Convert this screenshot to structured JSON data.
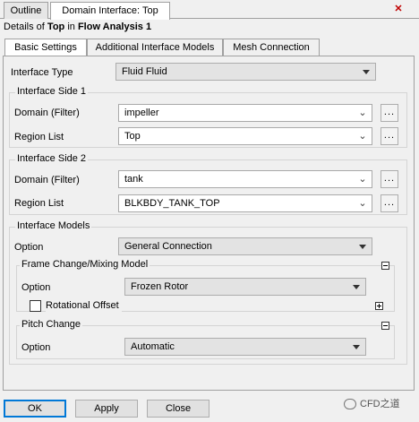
{
  "tabs": {
    "outline": "Outline",
    "domain_interface": "Domain Interface: Top"
  },
  "header": {
    "details_prefix": "Details of ",
    "object": "Top",
    "in_text": " in ",
    "analysis": "Flow Analysis 1"
  },
  "inner_tabs": {
    "basic": "Basic Settings",
    "additional": "Additional Interface Models",
    "mesh": "Mesh Connection"
  },
  "interface_type": {
    "label": "Interface Type",
    "value": "Fluid Fluid"
  },
  "side1": {
    "title": "Interface Side 1",
    "domain_label": "Domain (Filter)",
    "domain_value": "impeller",
    "region_label": "Region List",
    "region_value": "Top"
  },
  "side2": {
    "title": "Interface Side 2",
    "domain_label": "Domain (Filter)",
    "domain_value": "tank",
    "region_label": "Region List",
    "region_value": "BLKBDY_TANK_TOP"
  },
  "models": {
    "title": "Interface Models",
    "option_label": "Option",
    "option_value": "General Connection"
  },
  "frame_change": {
    "title": "Frame Change/Mixing Model",
    "option_label": "Option",
    "option_value": "Frozen Rotor",
    "rotational_offset_label": "Rotational Offset"
  },
  "pitch_change": {
    "title": "Pitch Change",
    "option_label": "Option",
    "option_value": "Automatic"
  },
  "buttons": {
    "ok": "OK",
    "apply": "Apply",
    "close": "Close"
  },
  "watermark": "CFD之道",
  "close_glyph": "✕",
  "dots_glyph": "...",
  "chevron_glyph": "⌄"
}
